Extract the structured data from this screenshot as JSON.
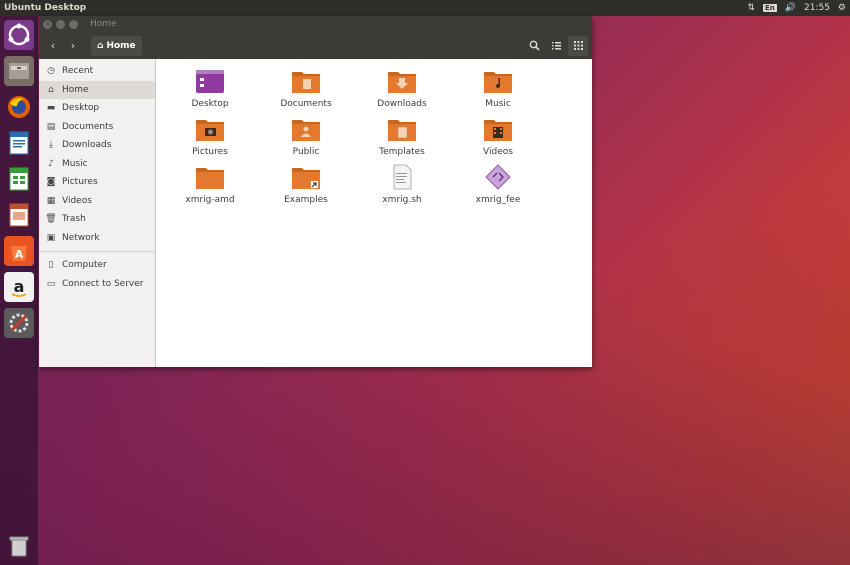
{
  "topbar": {
    "title": "Ubuntu Desktop",
    "keyboard": "En",
    "time": "21:55"
  },
  "launcher": {
    "items": [
      "ubuntu-dash",
      "files",
      "firefox",
      "libreoffice-writer",
      "libreoffice-calc",
      "libreoffice-impress",
      "ubuntu-software",
      "amazon",
      "system-settings",
      "trash"
    ]
  },
  "window": {
    "title": "Home",
    "path_label": "Home"
  },
  "sidebar": {
    "items": [
      {
        "label": "Recent",
        "icon": "clock-icon"
      },
      {
        "label": "Home",
        "icon": "home-icon"
      },
      {
        "label": "Desktop",
        "icon": "folder-icon"
      },
      {
        "label": "Documents",
        "icon": "document-icon"
      },
      {
        "label": "Downloads",
        "icon": "download-icon"
      },
      {
        "label": "Music",
        "icon": "music-icon"
      },
      {
        "label": "Pictures",
        "icon": "camera-icon"
      },
      {
        "label": "Videos",
        "icon": "video-icon"
      },
      {
        "label": "Trash",
        "icon": "trash-icon"
      },
      {
        "label": "Network",
        "icon": "network-icon"
      }
    ],
    "devices": [
      {
        "label": "Computer",
        "icon": "computer-icon"
      },
      {
        "label": "Connect to Server",
        "icon": "server-icon"
      }
    ]
  },
  "files": [
    {
      "label": "Desktop",
      "type": "desktop-folder"
    },
    {
      "label": "Documents",
      "type": "documents-folder"
    },
    {
      "label": "Downloads",
      "type": "downloads-folder"
    },
    {
      "label": "Music",
      "type": "music-folder"
    },
    {
      "label": "Pictures",
      "type": "pictures-folder"
    },
    {
      "label": "Public",
      "type": "public-folder"
    },
    {
      "label": "Templates",
      "type": "templates-folder"
    },
    {
      "label": "Videos",
      "type": "videos-folder"
    },
    {
      "label": "xmrig-amd",
      "type": "folder"
    },
    {
      "label": "Examples",
      "type": "link-folder"
    },
    {
      "label": "xmrig.sh",
      "type": "script-file"
    },
    {
      "label": "xmrig_fee",
      "type": "binary-file"
    }
  ],
  "colors": {
    "accent": "#e95420",
    "panel": "#2f2e2b",
    "folder": "#e2792f"
  }
}
